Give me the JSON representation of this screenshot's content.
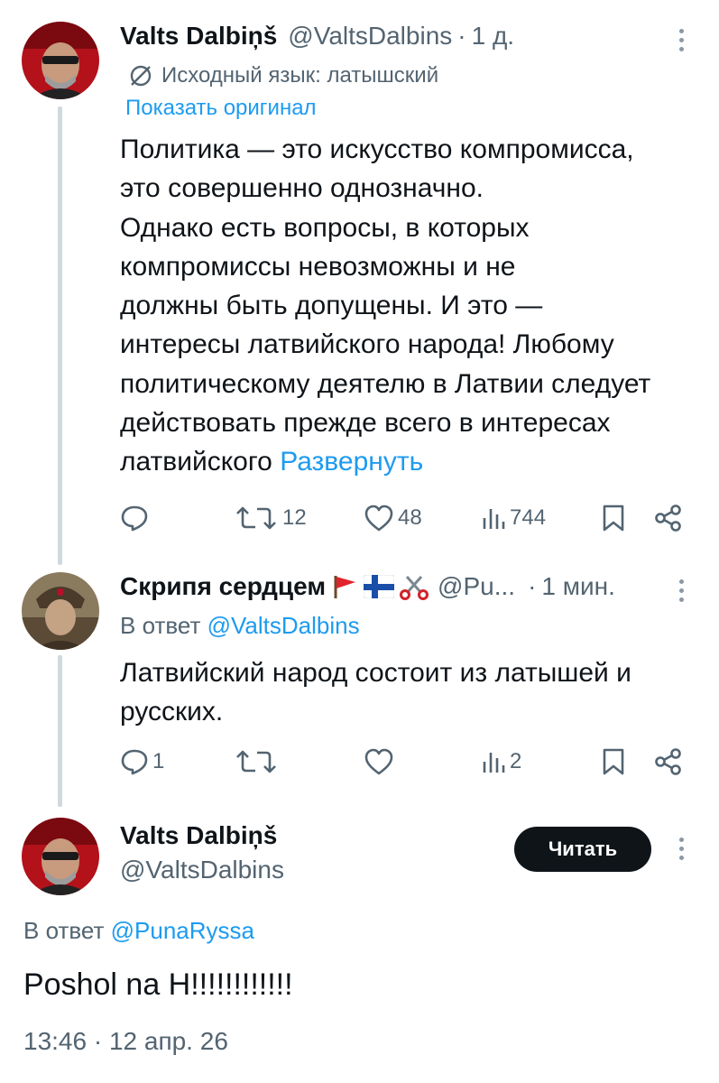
{
  "tweet1": {
    "name": "Valts Dalbiņš",
    "handle": "@ValtsDalbins",
    "dot": "·",
    "time": "1 д.",
    "translated_label": "Исходный язык: латышский",
    "show_original": "Показать оригинал",
    "text": "Политика — это искусство компромисса,\nэто совершенно однозначно.\nОднако есть вопросы, в которых\nкомпромиссы невозможны и не\nдолжны быть допущены. И это —\nинтересы латвийского народа! Любому\nполитическому деятелю в Латвии следует\nдействовать прежде всего в интересах\nлатвийского ",
    "expand": "Развернуть",
    "actions": {
      "reply_count": "",
      "retweet_count": "12",
      "like_count": "48",
      "views_count": "744"
    }
  },
  "tweet2": {
    "name": "Скрипя сердцем",
    "handle": "@Pu...",
    "dot": "·",
    "time": "1 мин.",
    "reply_prefix": "В ответ",
    "reply_mention": "@ValtsDalbins",
    "text": "Латвийский народ состоит из латышей и\nрусских.",
    "actions": {
      "reply_count": "1",
      "retweet_count": "",
      "like_count": "",
      "views_count": "2"
    }
  },
  "tweet3": {
    "name": "Valts Dalbiņš",
    "handle": "@ValtsDalbins",
    "read_button": "Читать",
    "reply_prefix": "В ответ",
    "reply_mention": "@PunaRyssa",
    "text": "Poshol na H!!!!!!!!!!!!",
    "timestamp": "13:46 · 12 апр. 26"
  },
  "colors": {
    "accent": "#1d9bf0",
    "secondary": "#536471",
    "text": "#0f1419",
    "thread": "#cfd9de"
  },
  "icons": [
    "translate-icon",
    "more-icon",
    "reply-icon",
    "retweet-icon",
    "like-icon",
    "views-icon",
    "bookmark-icon",
    "share-icon",
    "red-flag-icon",
    "finland-flag-icon",
    "scissors-icon"
  ]
}
